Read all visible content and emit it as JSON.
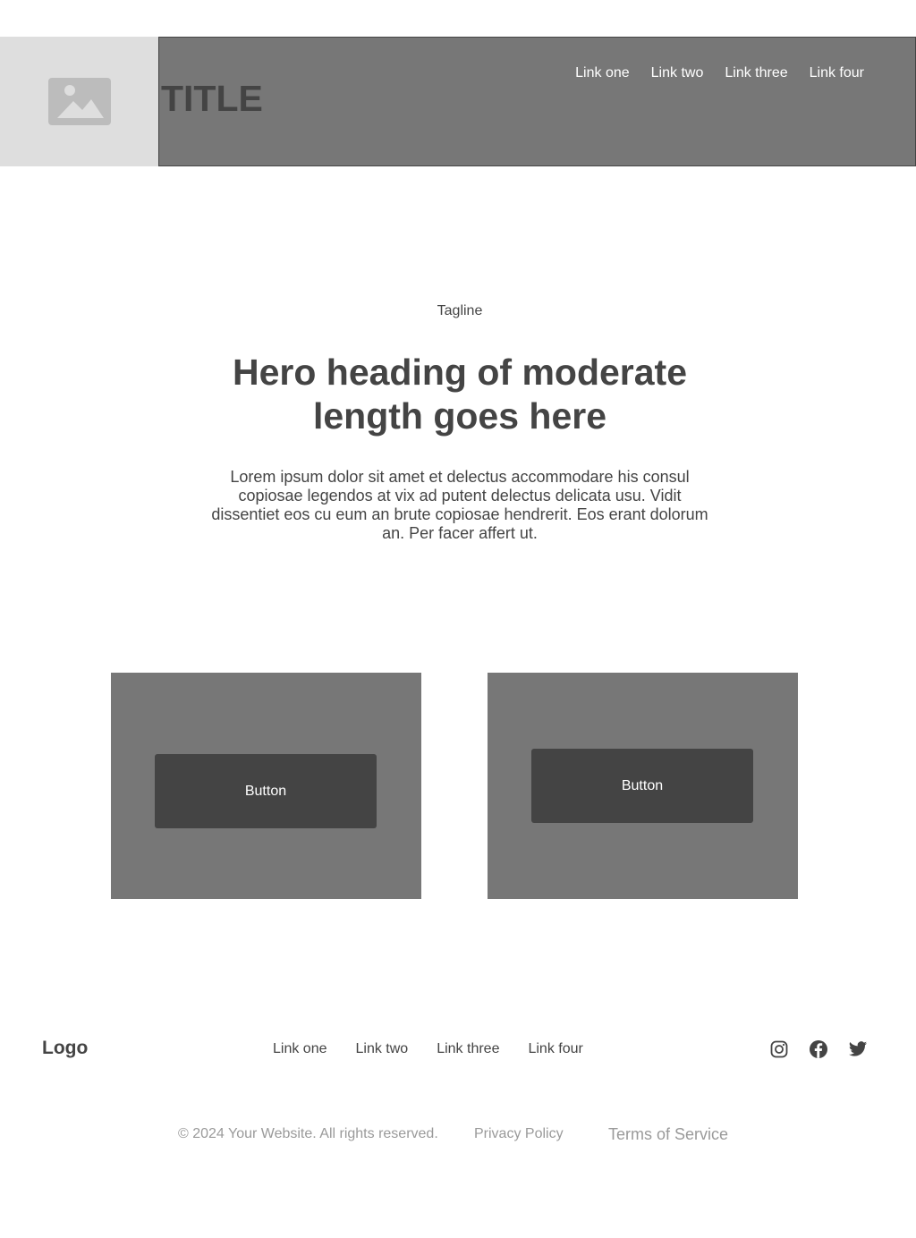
{
  "header": {
    "image_icon": "image-placeholder-icon",
    "title": "TITLE",
    "nav": [
      "Link one",
      "Link two",
      "Link three",
      "Link four"
    ]
  },
  "hero": {
    "tagline": "Tagline",
    "heading": "Hero heading of moderate length goes here",
    "body": "Lorem ipsum dolor sit amet et delectus accommodare his consul copiosae legendos at vix ad putent delectus delicata usu. Vidit dissentiet eos cu eum an brute copiosae hendrerit. Eos erant dolorum an. Per facer affert ut."
  },
  "cards": [
    {
      "button_label": "Button"
    },
    {
      "button_label": "Button"
    }
  ],
  "footer": {
    "logo": "Logo",
    "nav": [
      "Link one",
      "Link two",
      "Link three",
      "Link four"
    ],
    "social_icons": [
      "instagram-icon",
      "facebook-icon",
      "twitter-icon"
    ],
    "copyright": "© 2024 Your Website. All rights reserved.",
    "privacy": "Privacy Policy",
    "terms": "Terms of Service"
  },
  "colors": {
    "header_bar": "#777777",
    "image_block": "#dedede",
    "card": "#777777",
    "button": "#444444",
    "text": "#444444",
    "legal_text": "#9a9a9a"
  }
}
